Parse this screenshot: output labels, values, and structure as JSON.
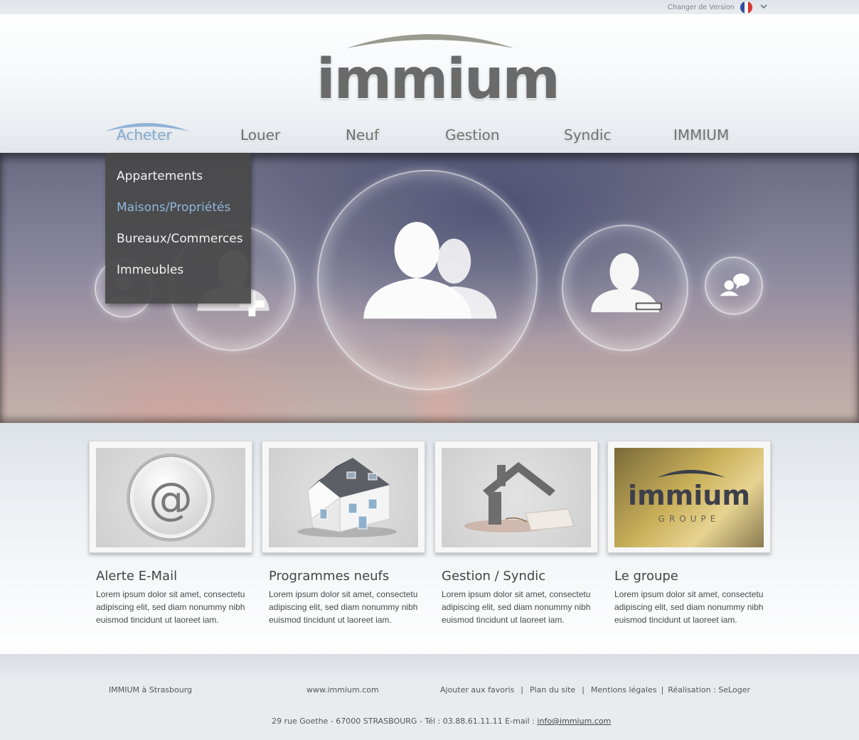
{
  "topbar": {
    "version_label": "Changer de Version"
  },
  "logo": {
    "text": "immium"
  },
  "nav": {
    "items": [
      "Acheter",
      "Louer",
      "Neuf",
      "Gestion",
      "Syndic",
      "IMMIUM"
    ],
    "active": "Acheter"
  },
  "dropdown": {
    "items": [
      "Appartements",
      "Maisons/Propriétés",
      "Bureaux/Commerces",
      "Immeubles"
    ],
    "highlighted": "Maisons/Propriétés"
  },
  "cards": [
    {
      "title": "Alerte E-Mail",
      "text": "Lorem ipsum dolor sit amet, consectetu adipiscing elit, sed diam nonummy nibh euismod tincidunt ut laoreet iam."
    },
    {
      "title": "Programmes neufs",
      "text": "Lorem ipsum dolor sit amet, consectetu adipiscing elit, sed diam nonummy nibh euismod tincidunt ut laoreet iam."
    },
    {
      "title": "Gestion / Syndic",
      "text": "Lorem ipsum dolor sit amet, consectetu adipiscing elit, sed diam nonummy nibh euismod tincidunt ut laoreet iam."
    },
    {
      "title": "Le groupe",
      "text": "Lorem ipsum dolor sit amet, consectetu adipiscing elit, sed diam nonummy nibh euismod tincidunt ut laoreet iam.",
      "image_logo_text": "immium",
      "image_sub_text": "GROUPE"
    }
  ],
  "footer": {
    "city": "IMMIUM à Strasbourg",
    "website": "www.immium.com",
    "links": [
      "Ajouter aux favoris",
      "Plan du site",
      "Mentions légales",
      "Réalisation : SeLoger"
    ],
    "separator": "|",
    "address": "29 rue Goethe - 67000 STRASBOURG  -  Tél : 03.88.61.11.11  E-mail :",
    "email": "info@immium.com"
  },
  "colors": {
    "accent": "#7ea8cf",
    "nav_text": "#6f6f6f",
    "dropdown_bg": "#484848",
    "flag": [
      "#2d4f9e",
      "#ffffff",
      "#d8352f"
    ]
  },
  "icons": [
    "chevron-down-icon",
    "flag-fr-icon",
    "add-user-icon",
    "group-icon",
    "remove-user-icon",
    "chat-user-icon",
    "at-sign-icon",
    "house-icon",
    "house-key-icon"
  ]
}
